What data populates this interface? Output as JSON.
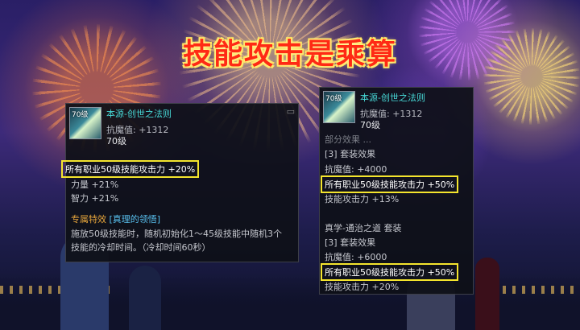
{
  "headline": "技能攻击是乘算",
  "left_tooltip": {
    "level_badge": "70级",
    "item_name": "本源-创世之法则",
    "resist": "抗魔值: +1312",
    "level": "70级",
    "highlight": "所有职业50级技能攻击力 +20%",
    "stat_str": "力量 +21%",
    "stat_int": "智力 +21%",
    "special_label": "专属特效",
    "special_name": "[真理的领悟]",
    "desc": "施放50级技能时，随机初始化1～45级技能中随机3个技能的冷却时间。（冷却时间60秒）"
  },
  "right_tooltip": {
    "level_badge": "70级",
    "item_name": "本源-创世之法则",
    "resist": "抗魔值: +1312",
    "level": "70级",
    "faded": "部分效果 ...",
    "set1_label": "[3] 套装效果",
    "set1_resist": "抗魔值: +4000",
    "set1_highlight": "所有职业50级技能攻击力 +50%",
    "set1_skill": "技能攻击力 +13%",
    "set2_title": "真学-通治之道 套装",
    "set2_label": "[3] 套装效果",
    "set2_resist": "抗魔值: +6000",
    "set2_highlight": "所有职业50级技能攻击力 +50%",
    "set2_skill": "技能攻击力 +20%"
  },
  "colors": {
    "headline": "#ff2a14",
    "item_name": "#47d8d6",
    "highlight_border": "#f4e52d",
    "special": "#e7a63b",
    "special_tag": "#59c2f0"
  }
}
